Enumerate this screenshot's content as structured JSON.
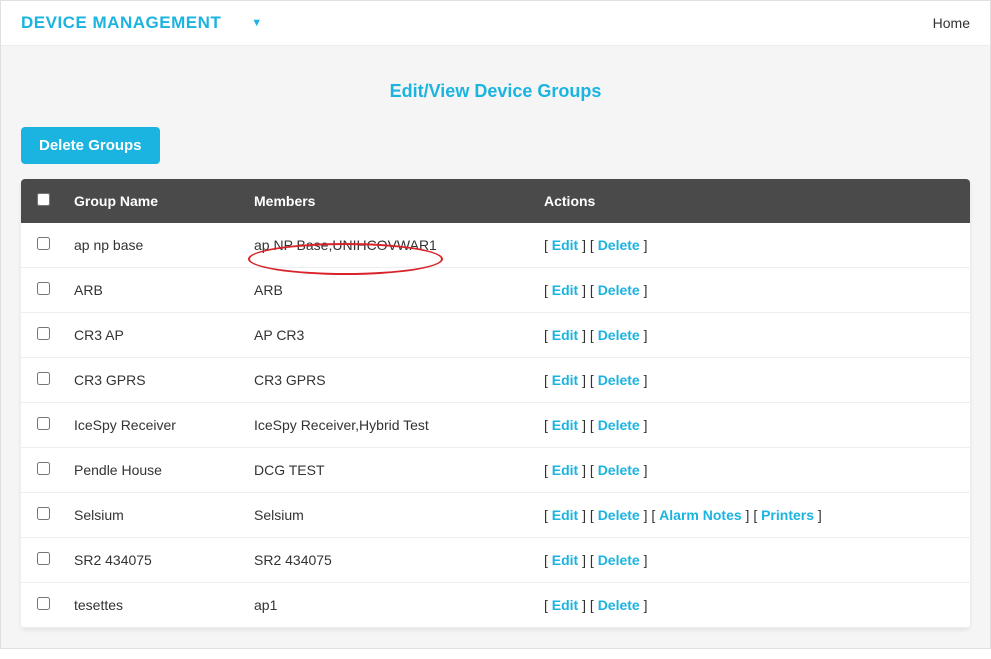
{
  "topbar": {
    "brand": "DEVICE MANAGEMENT",
    "home": "Home"
  },
  "page": {
    "title": "Edit/View Device Groups",
    "delete_button": "Delete Groups"
  },
  "headers": {
    "group_name": "Group Name",
    "members": "Members",
    "actions": "Actions"
  },
  "actions": {
    "edit": "Edit",
    "delete": "Delete",
    "alarm_notes": "Alarm Notes",
    "printers": "Printers"
  },
  "rows": [
    {
      "name": "ap np base",
      "members": "ap NP Base,UNIHCOVWAR1",
      "extra": false,
      "circled": true
    },
    {
      "name": "ARB",
      "members": "ARB",
      "extra": false,
      "circled": false
    },
    {
      "name": "CR3 AP",
      "members": "AP CR3",
      "extra": false,
      "circled": false
    },
    {
      "name": "CR3 GPRS",
      "members": "CR3 GPRS",
      "extra": false,
      "circled": false
    },
    {
      "name": "IceSpy Receiver",
      "members": "IceSpy Receiver,Hybrid Test",
      "extra": false,
      "circled": false
    },
    {
      "name": "Pendle House",
      "members": "DCG TEST",
      "extra": false,
      "circled": false
    },
    {
      "name": "Selsium",
      "members": "Selsium",
      "extra": true,
      "circled": false
    },
    {
      "name": "SR2 434075",
      "members": "SR2 434075",
      "extra": false,
      "circled": false
    },
    {
      "name": "tesettes",
      "members": "ap1",
      "extra": false,
      "circled": false
    }
  ]
}
